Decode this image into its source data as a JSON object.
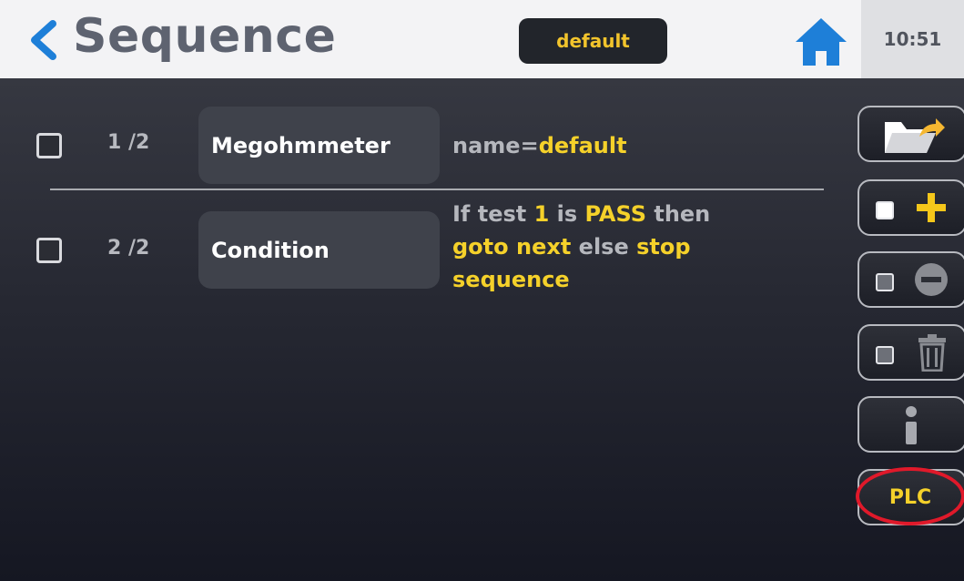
{
  "header": {
    "title": "Sequence",
    "sequence_name": "default",
    "time": "10:51"
  },
  "rows": [
    {
      "index": "1 /2",
      "test": "Megohmmeter",
      "detail": {
        "key": "name=",
        "value": "default"
      }
    },
    {
      "index": "2 /2",
      "test": "Condition",
      "detail": {
        "p1": "If test ",
        "test_no": "1",
        "p2": " is ",
        "result": "PASS",
        "p3": " then",
        "then_action": "goto next",
        "p4": " else ",
        "else_action_a": "stop",
        "else_action_b": "sequence"
      }
    }
  ],
  "toolbar": {
    "plc_label": "PLC",
    "icons": [
      "folder-export-icon",
      "add-icon",
      "remove-icon",
      "trash-icon",
      "info-icon"
    ]
  },
  "colors": {
    "accent_yellow": "#f5d12a",
    "back_blue": "#1e7fd8",
    "highlight_red": "#e0192a"
  }
}
